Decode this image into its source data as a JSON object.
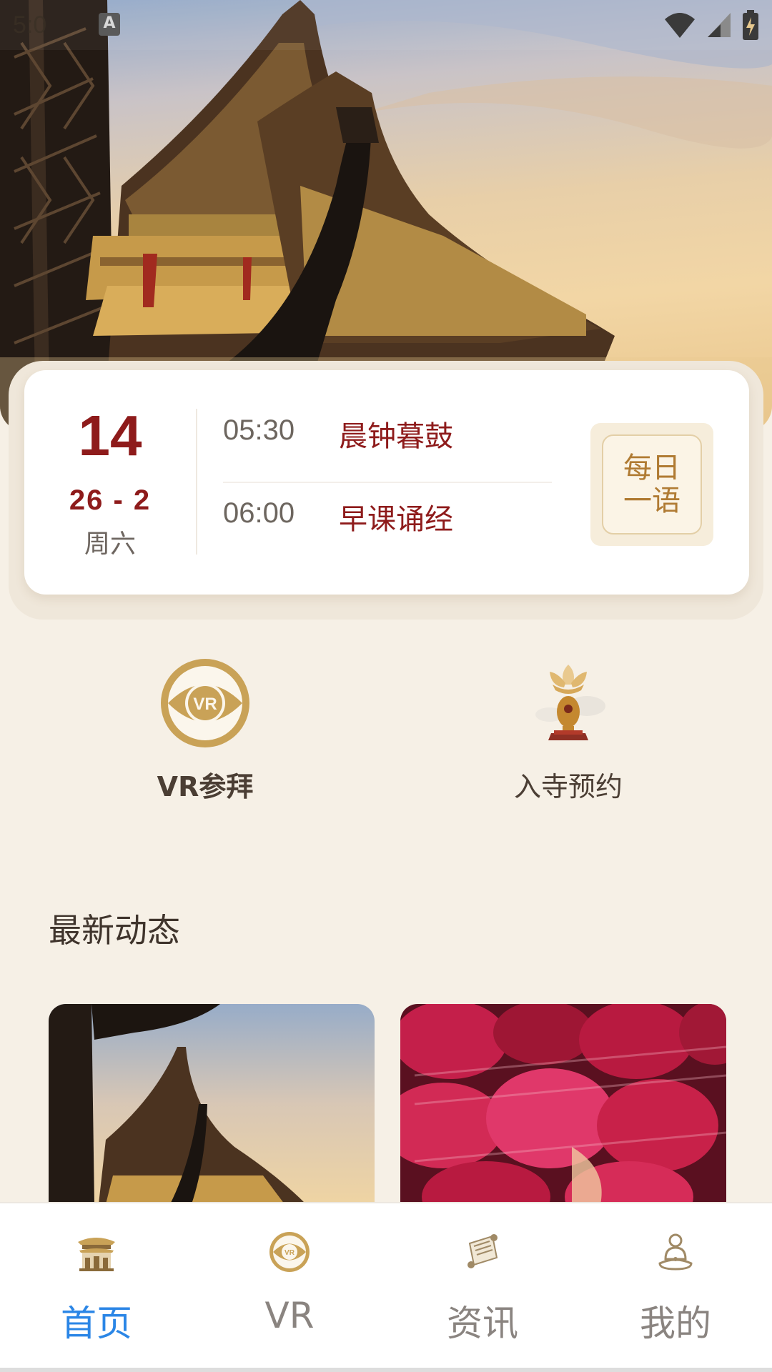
{
  "status_bar": {
    "time": "5:0",
    "notification_badge": "A"
  },
  "schedule": {
    "day": "14",
    "month_line": "26 - 2",
    "weekday": "周六",
    "items": [
      {
        "time": "05:30",
        "title": "晨钟暮鼓"
      },
      {
        "time": "06:00",
        "title": "早课诵经"
      }
    ],
    "daily_quote_label": "每日一语"
  },
  "actions": {
    "vr_label": "VR参拜",
    "temple_label": "入寺预约"
  },
  "news": {
    "section_title": "最新动态"
  },
  "nav": {
    "items": [
      {
        "label": "首页",
        "icon": "temple-gate-icon",
        "active": true
      },
      {
        "label": "VR",
        "icon": "vr-eye-icon",
        "active": false
      },
      {
        "label": "资讯",
        "icon": "scroll-icon",
        "active": false
      },
      {
        "label": "我的",
        "icon": "buddha-icon",
        "active": false
      }
    ]
  },
  "colors": {
    "accent_red": "#8e1b1b",
    "gold": "#c9a257",
    "active_tab": "#2b86e6",
    "background": "#f6f0e6"
  }
}
